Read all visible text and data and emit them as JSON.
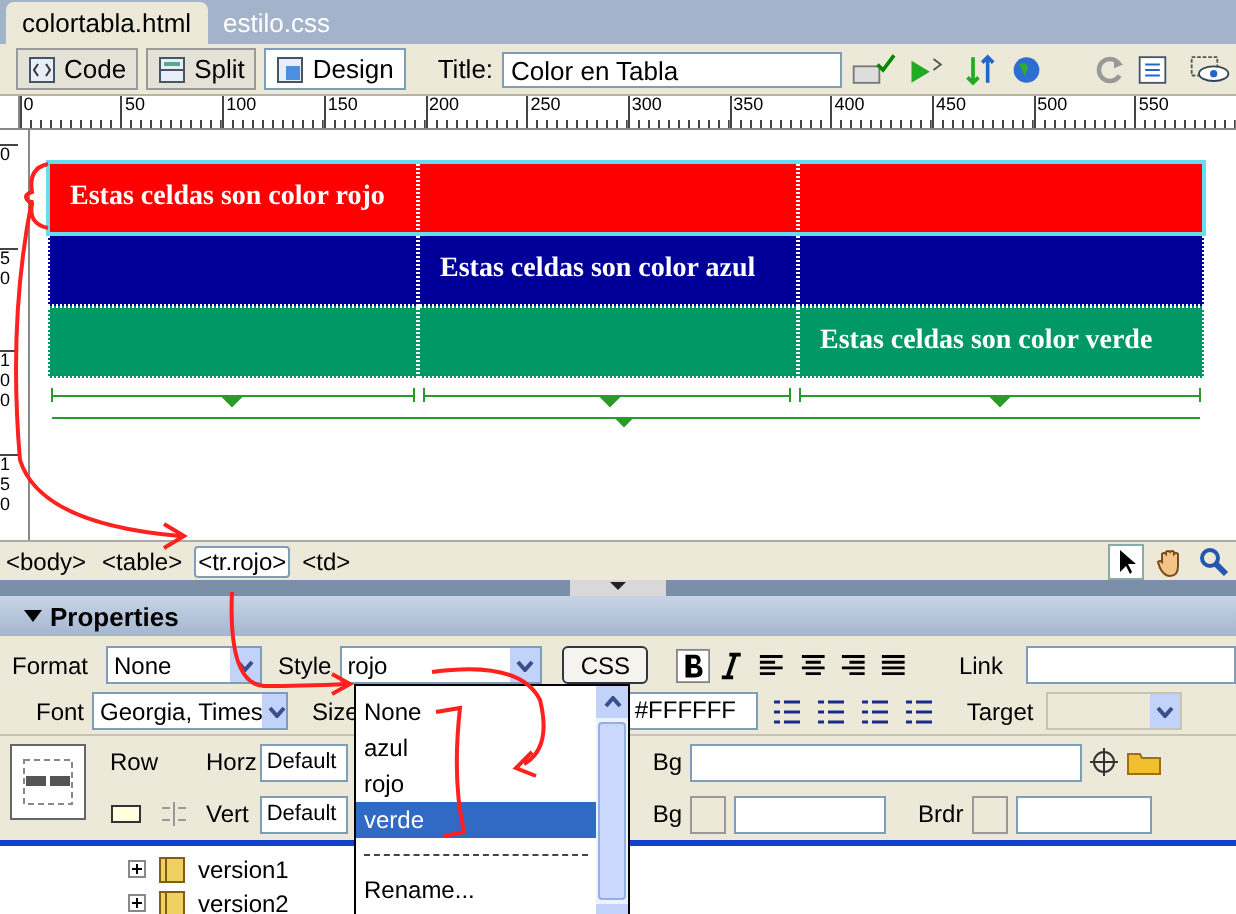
{
  "document_tabs": [
    {
      "label": "colortabla.html",
      "selected": true
    },
    {
      "label": "estilo.css",
      "selected": false
    }
  ],
  "toolbar": {
    "view_buttons": [
      {
        "label": "Code",
        "selected": false
      },
      {
        "label": "Split",
        "selected": false
      },
      {
        "label": "Design",
        "selected": true
      }
    ],
    "title_label": "Title:",
    "title_value": "Color en Tabla"
  },
  "ruler": {
    "horizontal": [
      "0",
      "50",
      "100",
      "150",
      "200",
      "250",
      "300",
      "350",
      "400",
      "450",
      "500",
      "550"
    ],
    "vertical": [
      "0",
      "50",
      "100",
      "150"
    ]
  },
  "table": {
    "rows": [
      {
        "color": "#ff0000",
        "selected": true,
        "cells": [
          {
            "kind": "text",
            "text": "Estas celdas son color rojo"
          },
          {
            "kind": "empty"
          },
          {
            "kind": "empty"
          }
        ]
      },
      {
        "color": "#000099",
        "selected": false,
        "cells": [
          {
            "kind": "empty"
          },
          {
            "kind": "text",
            "text": "Estas celdas son color azul"
          },
          {
            "kind": "empty"
          }
        ]
      },
      {
        "color": "#009966",
        "selected": false,
        "cells": [
          {
            "kind": "empty"
          },
          {
            "kind": "empty"
          },
          {
            "kind": "text",
            "text": "Estas celdas son color verde"
          }
        ]
      }
    ]
  },
  "tag_selector": [
    {
      "label": "<body>",
      "selected": false
    },
    {
      "label": "<table>",
      "selected": false
    },
    {
      "label": "<tr.rojo>",
      "selected": true
    },
    {
      "label": "<td>",
      "selected": false
    }
  ],
  "properties": {
    "title": "Properties",
    "format_label": "Format",
    "format_value": "None",
    "style_label": "Style",
    "style_value": "rojo",
    "css_button": "CSS",
    "link_label": "Link",
    "font_label": "Font",
    "font_value": "Georgia, Times",
    "size_label": "Size",
    "color_value": "#FFFFFF",
    "target_label": "Target",
    "row_label": "Row",
    "horz_label": "Horz",
    "horz_value": "Default",
    "vert_label": "Vert",
    "vert_value": "Default",
    "bg_label": "Bg",
    "bg2_label": "Bg",
    "brdr_label": "Brdr"
  },
  "style_dropdown": {
    "items": [
      {
        "label": "None",
        "selected": false
      },
      {
        "label": "azul",
        "selected": false
      },
      {
        "label": "rojo",
        "selected": false
      },
      {
        "label": "verde",
        "selected": true
      }
    ],
    "rename": "Rename..."
  },
  "files": [
    {
      "label": "version1"
    },
    {
      "label": "version2"
    }
  ]
}
